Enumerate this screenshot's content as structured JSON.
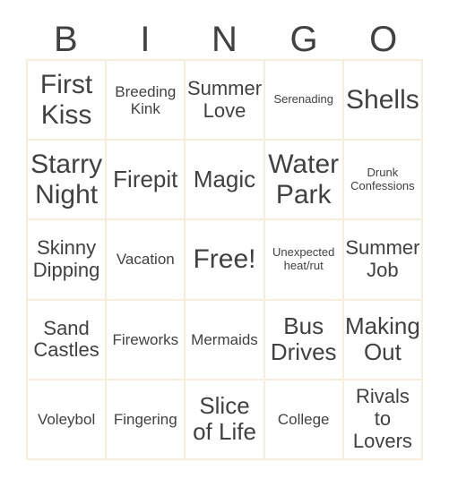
{
  "card": {
    "background_color": "#ffffff",
    "grid_line_color": "#f7eeda",
    "text_color": "#414141"
  },
  "header": {
    "letters": [
      "B",
      "I",
      "N",
      "G",
      "O"
    ]
  },
  "grid": {
    "columns": 5,
    "rows": 5,
    "free_space": "Free!",
    "cells": [
      {
        "text": "First Kiss",
        "size": "fs-xl"
      },
      {
        "text": "Breeding Kink",
        "size": "fs-sm"
      },
      {
        "text": "Summer Love",
        "size": "fs-md"
      },
      {
        "text": "Serenading",
        "size": "fs-xs"
      },
      {
        "text": "Shells",
        "size": "fs-xl"
      },
      {
        "text": "Starry Night",
        "size": "fs-xl"
      },
      {
        "text": "Firepit",
        "size": "fs-lg"
      },
      {
        "text": "Magic",
        "size": "fs-lg"
      },
      {
        "text": "Water Park",
        "size": "fs-xl"
      },
      {
        "text": "Drunk Confessions",
        "size": "fs-xs"
      },
      {
        "text": "Skinny Dipping",
        "size": "fs-md"
      },
      {
        "text": "Vacation",
        "size": "fs-sm"
      },
      {
        "text": "Free!",
        "size": "fs-xl"
      },
      {
        "text": "Unexpected heat/rut",
        "size": "fs-xs"
      },
      {
        "text": "Summer Job",
        "size": "fs-md"
      },
      {
        "text": "Sand Castles",
        "size": "fs-md"
      },
      {
        "text": "Fireworks",
        "size": "fs-sm"
      },
      {
        "text": "Mermaids",
        "size": "fs-sm"
      },
      {
        "text": "Bus Drives",
        "size": "fs-lg"
      },
      {
        "text": "Making Out",
        "size": "fs-lg"
      },
      {
        "text": "Voleybol",
        "size": "fs-sm"
      },
      {
        "text": "Fingering",
        "size": "fs-sm"
      },
      {
        "text": "Slice of Life",
        "size": "fs-lg"
      },
      {
        "text": "College",
        "size": "fs-sm"
      },
      {
        "text": "Rivals to Lovers",
        "size": "fs-md"
      }
    ]
  }
}
